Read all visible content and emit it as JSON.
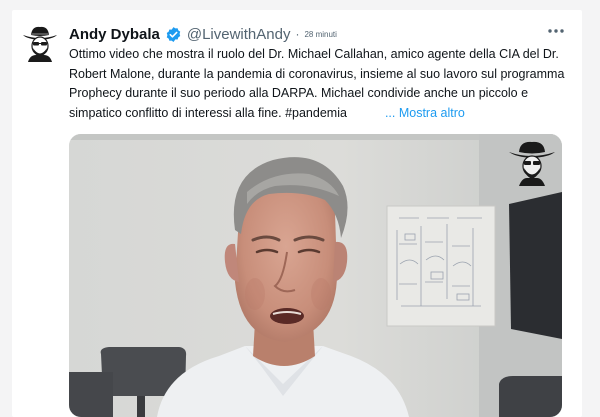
{
  "tweet": {
    "author_name": "Andy Dybala",
    "handle": "@LivewithAndy",
    "separator": "·",
    "time": "28 minuti",
    "verified_color": "#1d9bf0",
    "more_icon": "more-horizontal-icon",
    "text": "Ottimo video che mostra il ruolo del Dr. Michael Callahan, amico agente della CIA del Dr. Robert Malone, durante la pandemia di coronavirus, insieme al suo lavoro sul programma  Prophecy durante il suo periodo alla DARPA. Michael condivide anche un piccolo e simpatico conflitto di interessi alla fine. #pandemia",
    "show_more": "... Mostra altro",
    "media": {
      "kind": "video-thumbnail",
      "description_icon": "cowboy-watermark-icon"
    }
  },
  "colors": {
    "text": "#0f1419",
    "secondary": "#536471",
    "link": "#1d9bf0",
    "background": "#f4f4f5"
  }
}
